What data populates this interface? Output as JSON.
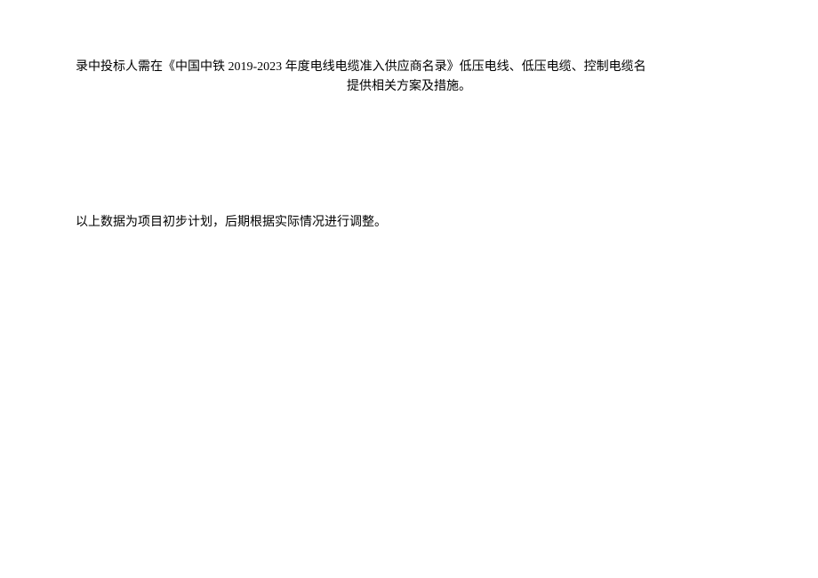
{
  "paragraphs": {
    "p1_line1": "录中投标人需在《中国中铁 2019-2023 年度电线电缆准入供应商名录》低压电线、低压电缆、控制电缆名",
    "p1_line2": "提供相关方案及措施。",
    "p2": "以上数据为项目初步计划，后期根据实际情况进行调整。"
  }
}
